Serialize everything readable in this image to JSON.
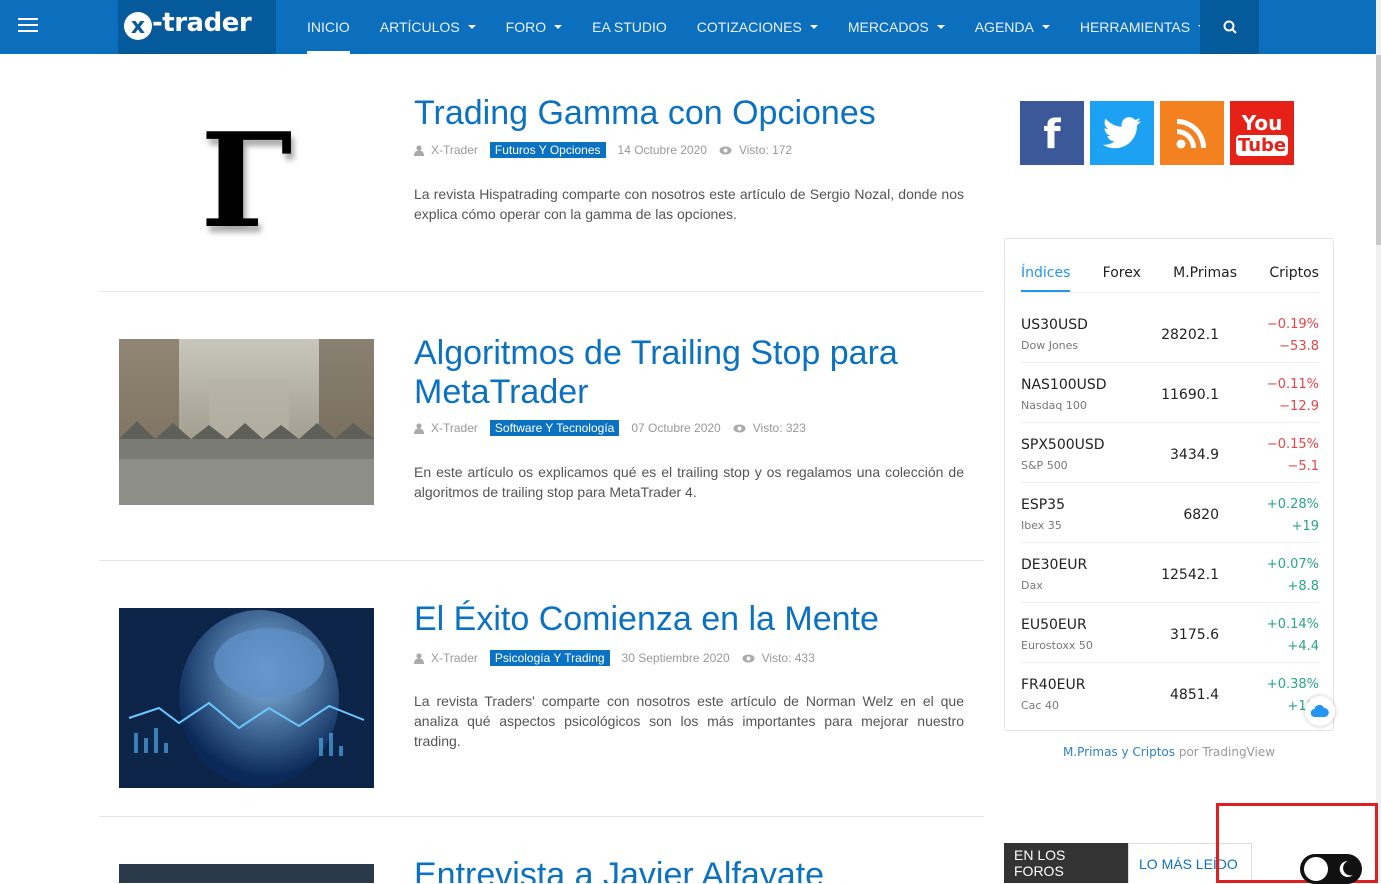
{
  "nav": {
    "logo_mark": "x",
    "logo_text": "-trader",
    "items": [
      {
        "label": "INICIO",
        "caret": false,
        "active": true
      },
      {
        "label": "ARTÍCULOS",
        "caret": true
      },
      {
        "label": "FORO",
        "caret": true
      },
      {
        "label": "EA STUDIO",
        "caret": false
      },
      {
        "label": "COTIZACIONES",
        "caret": true
      },
      {
        "label": "MERCADOS",
        "caret": true
      },
      {
        "label": "AGENDA",
        "caret": true
      },
      {
        "label": "HERRAMIENTAS",
        "caret": true
      }
    ],
    "menu_icon": "hamburger-icon",
    "search_icon": "search-icon"
  },
  "articles": [
    {
      "title": "Trading Gamma con Opciones",
      "thumb_glyph": "Γ",
      "author": "X-Trader",
      "category": "Futuros Y Opciones",
      "date": "14 Octubre 2020",
      "views": "Visto: 172",
      "excerpt": "La revista Hispatrading comparte con nosotros este artículo de Sergio Nozal, donde nos explica cómo operar con la gamma de las opciones."
    },
    {
      "title": "Algoritmos de Trailing Stop para MetaTrader",
      "author": "X-Trader",
      "category": "Software Y Tecnología",
      "date": "07 Octubre 2020",
      "views": "Visto: 323",
      "excerpt": "En este artículo os explicamos qué es el trailing stop y os regalamos una colección de algoritmos de trailing stop para MetaTrader 4."
    },
    {
      "title": "El Éxito Comienza en la Mente",
      "author": "X-Trader",
      "category": "Psicología Y Trading",
      "date": "30 Septiembre 2020",
      "views": "Visto: 433",
      "excerpt": "La revista Traders' comparte con nosotros este artículo de Norman Welz en el que analiza qué aspectos psicológicos son los más importantes para mejorar nuestro trading."
    },
    {
      "title": "Entrevista a Javier Alfayate"
    }
  ],
  "social": [
    {
      "name": "facebook-icon",
      "glyph": "f",
      "color": "#3b5998"
    },
    {
      "name": "twitter-icon",
      "glyph": "",
      "color": "#1da1f2"
    },
    {
      "name": "rss-icon",
      "glyph": "",
      "color": "#f48120"
    },
    {
      "name": "youtube-icon",
      "glyph_top": "You",
      "glyph_bottom": "Tube",
      "color": "#e62117"
    }
  ],
  "market_widget": {
    "tabs": [
      "Índices",
      "Forex",
      "M.Primas",
      "Criptos"
    ],
    "active_tab": "Índices",
    "rows": [
      {
        "symbol": "US30USD",
        "name": "Dow Jones",
        "price": "28202.1",
        "pct": "−0.19%",
        "chg": "−53.8",
        "dir": "neg"
      },
      {
        "symbol": "NAS100USD",
        "name": "Nasdaq 100",
        "price": "11690.1",
        "pct": "−0.11%",
        "chg": "−12.9",
        "dir": "neg"
      },
      {
        "symbol": "SPX500USD",
        "name": "S&P 500",
        "price": "3434.9",
        "pct": "−0.15%",
        "chg": "−5.1",
        "dir": "neg"
      },
      {
        "symbol": "ESP35",
        "name": "Ibex 35",
        "price": "6820",
        "pct": "+0.28%",
        "chg": "+19",
        "dir": "pos"
      },
      {
        "symbol": "DE30EUR",
        "name": "Dax",
        "price": "12542.1",
        "pct": "+0.07%",
        "chg": "+8.8",
        "dir": "pos"
      },
      {
        "symbol": "EU50EUR",
        "name": "Eurostoxx 50",
        "price": "3175.6",
        "pct": "+0.14%",
        "chg": "+4.4",
        "dir": "pos"
      },
      {
        "symbol": "FR40EUR",
        "name": "Cac 40",
        "price": "4851.4",
        "pct": "+0.38%",
        "chg": "+18.",
        "dir": "pos"
      }
    ],
    "credit_link": "M.Primas y Criptos",
    "credit_by": "por TradingView"
  },
  "bottom_tabs": {
    "forums": "EN LOS FOROS",
    "most_read": "LO MÁS LEÍDO"
  },
  "colors": {
    "nav_bg": "#0b6fbe",
    "accent": "#0b72c1",
    "negative": "#e54545",
    "positive": "#2aa48a"
  }
}
